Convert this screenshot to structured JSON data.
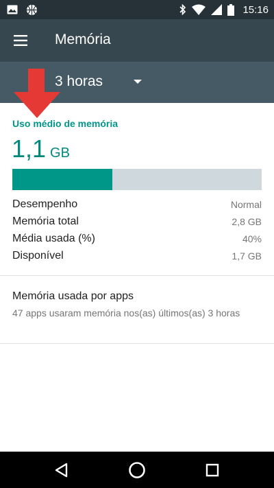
{
  "status_bar": {
    "time": "15:16",
    "icons_left": [
      "image-icon",
      "basketball-icon"
    ],
    "icons_right": [
      "bluetooth-icon",
      "wifi-icon",
      "cell-signal-icon",
      "battery-icon"
    ]
  },
  "app_bar": {
    "title": "Memória",
    "menu_icon": "menu-icon"
  },
  "time_range": {
    "selected": "3 horas"
  },
  "memory": {
    "section_title": "Uso médio de memória",
    "average_value": "1,1",
    "average_unit": "GB",
    "usage_fraction": 0.4,
    "stats": [
      {
        "label": "Desempenho",
        "value": "Normal"
      },
      {
        "label": "Memória total",
        "value": "2,8 GB"
      },
      {
        "label": "Média usada (%)",
        "value": "40%"
      },
      {
        "label": "Disponível",
        "value": "1,7 GB"
      }
    ]
  },
  "apps_memory": {
    "title": "Memória usada por apps",
    "subtitle": "47 apps usaram memória nos(as) últimos(as) 3 horas"
  },
  "colors": {
    "accent": "#009688",
    "status_bar": "#263238",
    "app_bar": "#37474f",
    "spinner_bar": "#455a64",
    "annotation_arrow": "#e53935"
  },
  "nav_bar": {
    "buttons": [
      "back-icon",
      "home-icon",
      "recents-icon"
    ]
  }
}
